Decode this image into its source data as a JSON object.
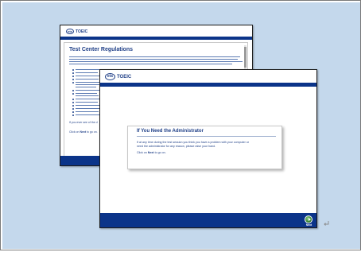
{
  "back_screen": {
    "logo_mark": "ets",
    "logo_word": "TOEIC",
    "title": "Test Center Regulations",
    "footer_note_prefix": "If you ever see of the d",
    "click_prefix": "Click on",
    "click_button": "Next",
    "click_suffix": "to go on."
  },
  "front_screen": {
    "logo_mark": "ets",
    "logo_word": "TOEIC",
    "panel": {
      "title": "If You Need the Administrator",
      "line1": "If at any time during the test session you think you have a problem with your computer or",
      "line2": "need the administrator for any reason, please raise your hand.",
      "click_prefix": "Click on",
      "click_button": "Next",
      "click_suffix": "to go on."
    },
    "next_button_label": "Next"
  },
  "colors": {
    "slide_background": "#c4d8ec",
    "brand_blue": "#0b3489",
    "text_blue": "#1f3f87",
    "next_green": "#3d8a38"
  },
  "icons": {
    "next": "play-arrow-icon",
    "return_mark": "paragraph-return-icon"
  }
}
